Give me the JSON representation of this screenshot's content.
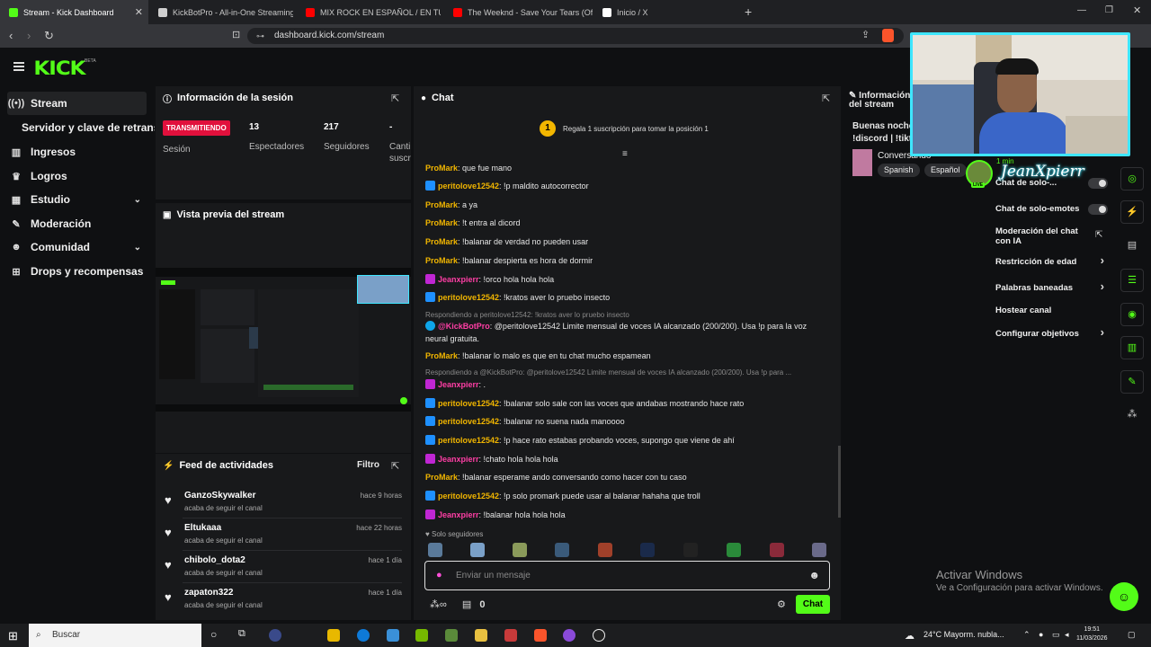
{
  "browser": {
    "tabs": [
      {
        "label": "Stream - Kick Dashboard",
        "color": "#53fc18"
      },
      {
        "label": "KickBotPro - All-in-One Streaming To",
        "color": "#cfcfcf"
      },
      {
        "label": "MIX ROCK EN ESPAÑOL / EN TU",
        "color": "#ff0000"
      },
      {
        "label": "The Weeknd - Save Your Tears (Offici",
        "color": "#ff0000"
      },
      {
        "label": "Inicio / X",
        "color": "#ffffff"
      }
    ],
    "new_tab": "+",
    "url": "dashboard.kick.com/stream"
  },
  "header": {
    "logo": "KICK",
    "beta": "BETA"
  },
  "sidebar": {
    "items": [
      {
        "label": "Stream",
        "icon": "broadcast-icon"
      },
      {
        "label": "Servidor y clave de retransmisión",
        "icon": ""
      },
      {
        "label": "Ingresos",
        "icon": "chart-icon"
      },
      {
        "label": "Logros",
        "icon": "trophy-icon"
      },
      {
        "label": "Estudio",
        "icon": "studio-icon"
      },
      {
        "label": "Moderación",
        "icon": "wrench-icon"
      },
      {
        "label": "Comunidad",
        "icon": "community-icon"
      },
      {
        "label": "Drops y recompensas",
        "icon": "drops-icon"
      }
    ]
  },
  "session": {
    "title": "Información de la sesión",
    "status": "TRANSMITIENDO",
    "session_label": "Sesión",
    "viewers": "13",
    "viewers_label": "Espectadores",
    "followers": "217",
    "followers_label": "Seguidores",
    "subs": "-",
    "subs_label": "Canti suscr"
  },
  "preview": {
    "title": "Vista previa del stream"
  },
  "feed": {
    "title": "Feed de actividades",
    "filter": "Filtro",
    "items": [
      {
        "name": "GanzoSkywalker",
        "action": "acaba de seguir el canal",
        "time": "hace 9 horas"
      },
      {
        "name": "Eltukaaa",
        "action": "acaba de seguir el canal",
        "time": "hace 22 horas"
      },
      {
        "name": "chibolo_dota2",
        "action": "acaba de seguir el canal",
        "time": "hace 1 día"
      },
      {
        "name": "zapaton322",
        "action": "acaba de seguir el canal",
        "time": "hace 1 día"
      }
    ]
  },
  "chat": {
    "title": "Chat",
    "gift_rank": "1",
    "gift_text": "Regala 1 suscripción para tomar la posición 1",
    "messages": [
      {
        "user": "ProMark",
        "color": "#f2b600",
        "badge": "",
        "text": ": que fue mano"
      },
      {
        "user": "peritolove12542",
        "color": "#f2b600",
        "badge": "#1e90ff",
        "text": ": !p maldito autocorrector"
      },
      {
        "user": "ProMark",
        "color": "#f2b600",
        "badge": "",
        "text": ": a ya"
      },
      {
        "user": "ProMark",
        "color": "#f2b600",
        "badge": "",
        "text": ": !t entra al dicord"
      },
      {
        "user": "ProMark",
        "color": "#f2b600",
        "badge": "",
        "text": ": !balanar de verdad no pueden usar"
      },
      {
        "user": "ProMark",
        "color": "#f2b600",
        "badge": "",
        "text": ": !balanar despierta es hora de dormir"
      },
      {
        "user": "Jeanxpierr",
        "color": "#ff3ea5",
        "badge": "#c026d3",
        "text": ": !orco hola hola hola"
      },
      {
        "user": "peritolove12542",
        "color": "#f2b600",
        "badge": "#1e90ff",
        "text": ": !kratos aver lo pruebo insecto"
      }
    ],
    "reply1": "Respondiendo a peritolove12542: !kratos aver lo pruebo insecto",
    "bot_msg": {
      "user": "@KickBotPro",
      "color": "#ff3ea5",
      "text": ": @peritolove12542 Limite mensual de voces IA alcanzado (200/200). Usa !p para la voz neural gratuita."
    },
    "messages2": [
      {
        "user": "ProMark",
        "color": "#f2b600",
        "badge": "",
        "text": ": !balanar lo malo es que en tu chat mucho espamean"
      }
    ],
    "reply2": "Respondiendo a @KickBotPro: @peritolove12542 Limite mensual de voces IA alcanzado (200/200). Usa !p para ...",
    "messages3": [
      {
        "user": "Jeanxpierr",
        "color": "#ff3ea5",
        "badge": "#c026d3",
        "text": ": ."
      },
      {
        "user": "peritolove12542",
        "color": "#f2b600",
        "badge": "#1e90ff",
        "text": ": !balanar solo sale con las voces que andabas mostrando hace rato"
      },
      {
        "user": "peritolove12542",
        "color": "#f2b600",
        "badge": "#1e90ff",
        "text": ": !balanar no suena nada manoooo"
      },
      {
        "user": "peritolove12542",
        "color": "#f2b600",
        "badge": "#1e90ff",
        "text": ": !p hace rato estabas probando voces, supongo que viene de ahí"
      },
      {
        "user": "Jeanxpierr",
        "color": "#ff3ea5",
        "badge": "#c026d3",
        "text": ": !chato hola hola hola"
      },
      {
        "user": "ProMark",
        "color": "#f2b600",
        "badge": "",
        "text": ": !balanar esperame ando conversando como hacer con tu caso"
      },
      {
        "user": "peritolove12542",
        "color": "#f2b600",
        "badge": "#1e90ff",
        "text": ": !p solo promark puede usar al balanar hahaha que troll"
      },
      {
        "user": "Jeanxpierr",
        "color": "#ff3ea5",
        "badge": "#c026d3",
        "text": ": !balanar hola hola hola"
      }
    ],
    "followers_only": "Solo seguidores",
    "input_placeholder": "Enviar un mensaje",
    "count": "0",
    "send": "Chat"
  },
  "info": {
    "title": "Información del stream",
    "stream_title": "Buenas noches !discord | !tiktok",
    "category": "Conversando",
    "tags": [
      "Spanish",
      "Español"
    ]
  },
  "settings": {
    "items": [
      {
        "label": "Chat de solo-...",
        "type": "toggle"
      },
      {
        "label": "Chat de solo-emotes",
        "type": "toggle"
      },
      {
        "label": "Moderación del chat con IA",
        "type": "link"
      },
      {
        "label": "Restricción de edad",
        "type": "arrow"
      },
      {
        "label": "Palabras baneadas",
        "type": "arrow"
      },
      {
        "label": "Hostear canal",
        "type": "none"
      },
      {
        "label": "Configurar objetivos",
        "type": "arrow"
      }
    ]
  },
  "webcam": {
    "name": "JeanXpierr",
    "time": "1 min",
    "live": "LIVE"
  },
  "windows": {
    "activate_title": "Activar Windows",
    "activate_sub": "Ve a Configuración para activar Windows.",
    "search": "Buscar",
    "weather": "24°C  Mayorm. nubla...",
    "time": "19:51",
    "date": "11/03/2026"
  }
}
